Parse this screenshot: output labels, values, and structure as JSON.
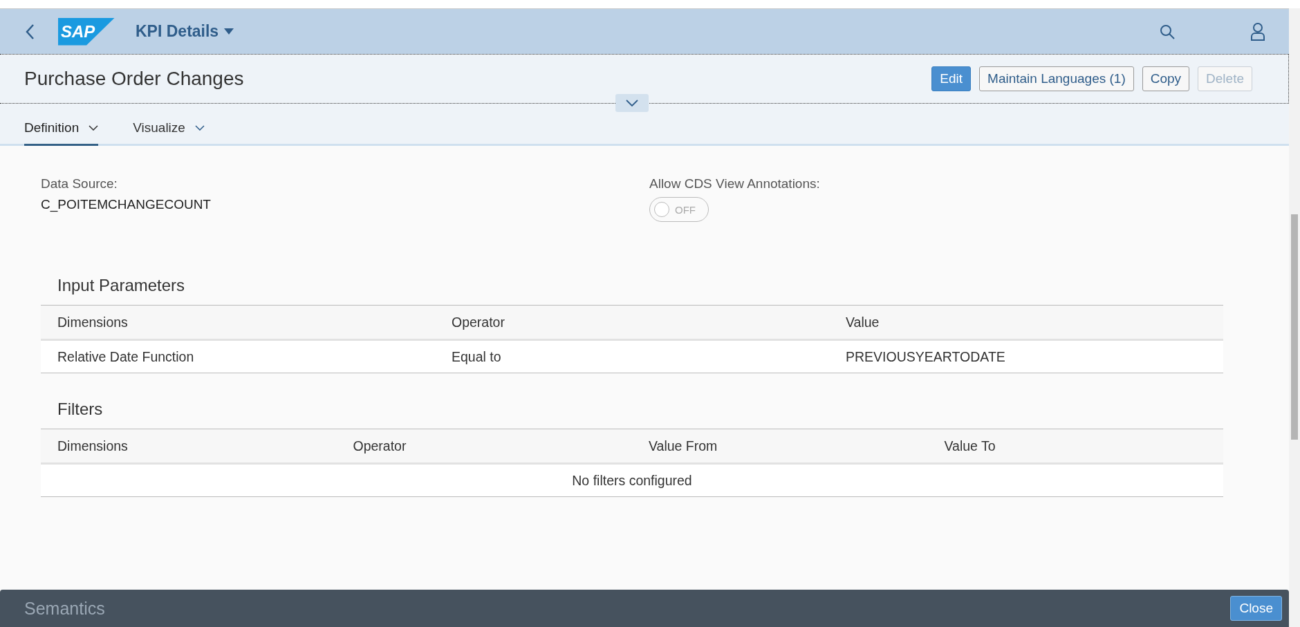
{
  "shell": {
    "title": "KPI Details",
    "logo": "SAP"
  },
  "header": {
    "title": "Purchase Order Changes",
    "actions": [
      {
        "label": "Edit",
        "kind": "emphasized",
        "disabled": false
      },
      {
        "label": "Maintain Languages (1)",
        "kind": "default",
        "disabled": false
      },
      {
        "label": "Copy",
        "kind": "default",
        "disabled": false
      },
      {
        "label": "Delete",
        "kind": "default",
        "disabled": true
      }
    ]
  },
  "tabs": [
    {
      "label": "Definition",
      "selected": true
    },
    {
      "label": "Visualize",
      "selected": false
    }
  ],
  "fields": [
    {
      "label": "Data Source:",
      "kind": "text",
      "value": "C_POITEMCHANGECOUNT"
    },
    {
      "label": "Allow CDS View Annotations:",
      "kind": "switch",
      "on": false,
      "off_text": "OFF"
    }
  ],
  "sections": [
    {
      "title": "Input Parameters",
      "columns": [
        "Dimensions",
        "Operator",
        "Value"
      ],
      "rows": [
        [
          "Relative Date Function",
          "Equal to",
          "PREVIOUSYEARTODATE"
        ]
      ]
    },
    {
      "title": "Filters",
      "columns": [
        "Dimensions",
        "Operator",
        "Value From",
        "Value To"
      ],
      "empty_text": "No filters configured"
    }
  ],
  "next_section": "Semantics",
  "footer": {
    "button": "Close"
  }
}
